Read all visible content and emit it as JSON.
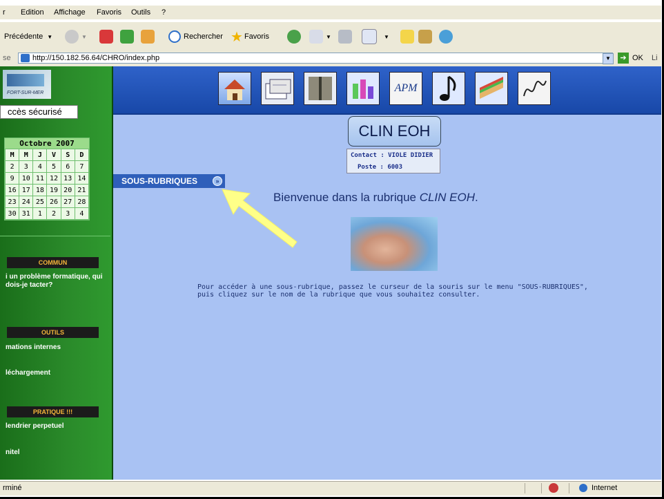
{
  "menu": {
    "items": [
      "r",
      "Edition",
      "Affichage",
      "Favoris",
      "Outils",
      "?"
    ]
  },
  "toolbar": {
    "back_label": "Précédente",
    "search_label": "Rechercher",
    "favorites_label": "Favoris"
  },
  "address": {
    "label": "se",
    "url": "http://150.182.56.64/CHRO/index.php",
    "go_label": "OK",
    "links_label": "Li"
  },
  "sidebar": {
    "logo_text": "FORT-SUR-MER",
    "secure_access": "ccès sécurisé",
    "calendar": {
      "month": "Octobre 2007",
      "headers": [
        "M",
        "M",
        "J",
        "V",
        "S",
        "D"
      ],
      "rows": [
        [
          "2",
          "3",
          "4",
          "5",
          "6",
          "7"
        ],
        [
          "9",
          "10",
          "11",
          "12",
          "13",
          "14"
        ],
        [
          "16",
          "17",
          "18",
          "19",
          "20",
          "21"
        ],
        [
          "23",
          "24",
          "25",
          "26",
          "27",
          "28"
        ],
        [
          "30",
          "31",
          "1",
          "2",
          "3",
          "4"
        ]
      ]
    },
    "commun_title": "COMMUN",
    "commun_link": "i un problème formatique, qui dois-je tacter?",
    "outils_title": "OUTILS",
    "outils_link1": "mations internes",
    "outils_link2": "léchargement",
    "pratique_title": "PRATIQUE !!!",
    "pratique_link1": "lendrier perpetuel",
    "pratique_link2": "nitel"
  },
  "banner": {
    "icons": [
      "home-icon",
      "documents-icon",
      "cabinet-icon",
      "lab-icon",
      "apm-icon",
      "music-note-icon",
      "sandwich-icon",
      "signature-icon"
    ],
    "apm_text": "APM"
  },
  "main": {
    "title": "CLIN EOH",
    "contact": "Contact : VIOLE DIDIER",
    "poste": "Poste : 6003",
    "sous_rubriques": "SOUS-RUBRIQUES",
    "welcome_prefix": "Bienvenue dans la rubrique ",
    "welcome_name": "CLIN EOH",
    "welcome_suffix": ".",
    "instructions_line1": "Pour accéder à une sous-rubrique, passez le curseur de la souris sur le menu \"SOUS-RUBRIQUES\",",
    "instructions_line2": "puis cliquez sur le nom de la rubrique que vous souhaitez consulter."
  },
  "status": {
    "left": "rminé",
    "zone": "Internet"
  }
}
